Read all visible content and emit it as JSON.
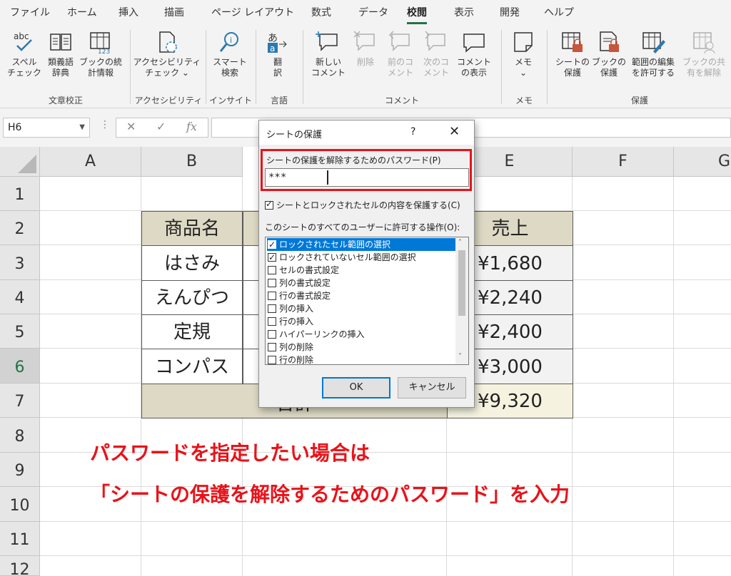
{
  "ribbon_tabs": [
    "ファイル",
    "ホーム",
    "挿入",
    "描画",
    "ページ レイアウト",
    "数式",
    "データ",
    "校閲",
    "表示",
    "開発",
    "ヘルプ"
  ],
  "active_tab": "校閲",
  "ribbon": {
    "spell": "スペル\nチェック",
    "thesaurus": "類義語\n辞典",
    "workbook_stats": "ブックの統\n計情報",
    "accessibility": "アクセシビリティ\nチェック ⌄",
    "smart_lookup": "スマート\n検索",
    "translate": "翻\n訳",
    "new_comment": "新しい\nコメント",
    "delete_comment": "削除",
    "prev_comment": "前のコ\nメント",
    "next_comment": "次のコ\nメント",
    "show_comments": "コメント\nの表示",
    "memo": "メモ\n⌄",
    "protect_sheet": "シートの\n保護",
    "protect_workbook": "ブックの\n保護",
    "allow_edit_ranges": "範囲の編集\nを許可する",
    "unshare_workbook": "ブックの共\n有を解除",
    "groups": {
      "proofing": "文章校正",
      "accessibility": "アクセシビリティ",
      "insights": "インサイト",
      "language": "言語",
      "comments": "コメント",
      "notes": "メモ",
      "protect": "保護"
    }
  },
  "name_box": "H6",
  "columns": [
    "A",
    "B",
    "E",
    "F",
    "G"
  ],
  "rows": [
    "1",
    "2",
    "3",
    "4",
    "5",
    "6",
    "7",
    "8",
    "9",
    "10",
    "11",
    "12"
  ],
  "table": {
    "header_name": "商品名",
    "header_sales": "売上",
    "rows": [
      {
        "name": "はさみ",
        "sales": "¥1,680"
      },
      {
        "name": "えんぴつ",
        "sales": "¥2,240"
      },
      {
        "name": "定規",
        "sales": "¥2,400"
      },
      {
        "name": "コンパス",
        "sales": "¥3,000"
      }
    ],
    "total_label": "合計",
    "total_value": "¥9,320"
  },
  "dialog": {
    "title": "シートの保護",
    "help": "?",
    "close": "✕",
    "password_label": "シートの保護を解除するためのパスワード(P)",
    "password_value": "***",
    "protect_locked_label": "シートとロックされたセルの内容を保護する(C)",
    "allow_label": "このシートのすべてのユーザーに許可する操作(O):",
    "options": [
      {
        "label": "ロックされたセル範囲の選択",
        "checked": true
      },
      {
        "label": "ロックされていないセル範囲の選択",
        "checked": true
      },
      {
        "label": "セルの書式設定",
        "checked": false
      },
      {
        "label": "列の書式設定",
        "checked": false
      },
      {
        "label": "行の書式設定",
        "checked": false
      },
      {
        "label": "列の挿入",
        "checked": false
      },
      {
        "label": "行の挿入",
        "checked": false
      },
      {
        "label": "ハイパーリンクの挿入",
        "checked": false
      },
      {
        "label": "列の削除",
        "checked": false
      },
      {
        "label": "行の削除",
        "checked": false
      }
    ],
    "ok": "OK",
    "cancel": "キャンセル"
  },
  "annotation": {
    "line1": "パスワードを指定したい場合は",
    "line2": "「シートの保護を解除するためのパスワード」を入力"
  }
}
